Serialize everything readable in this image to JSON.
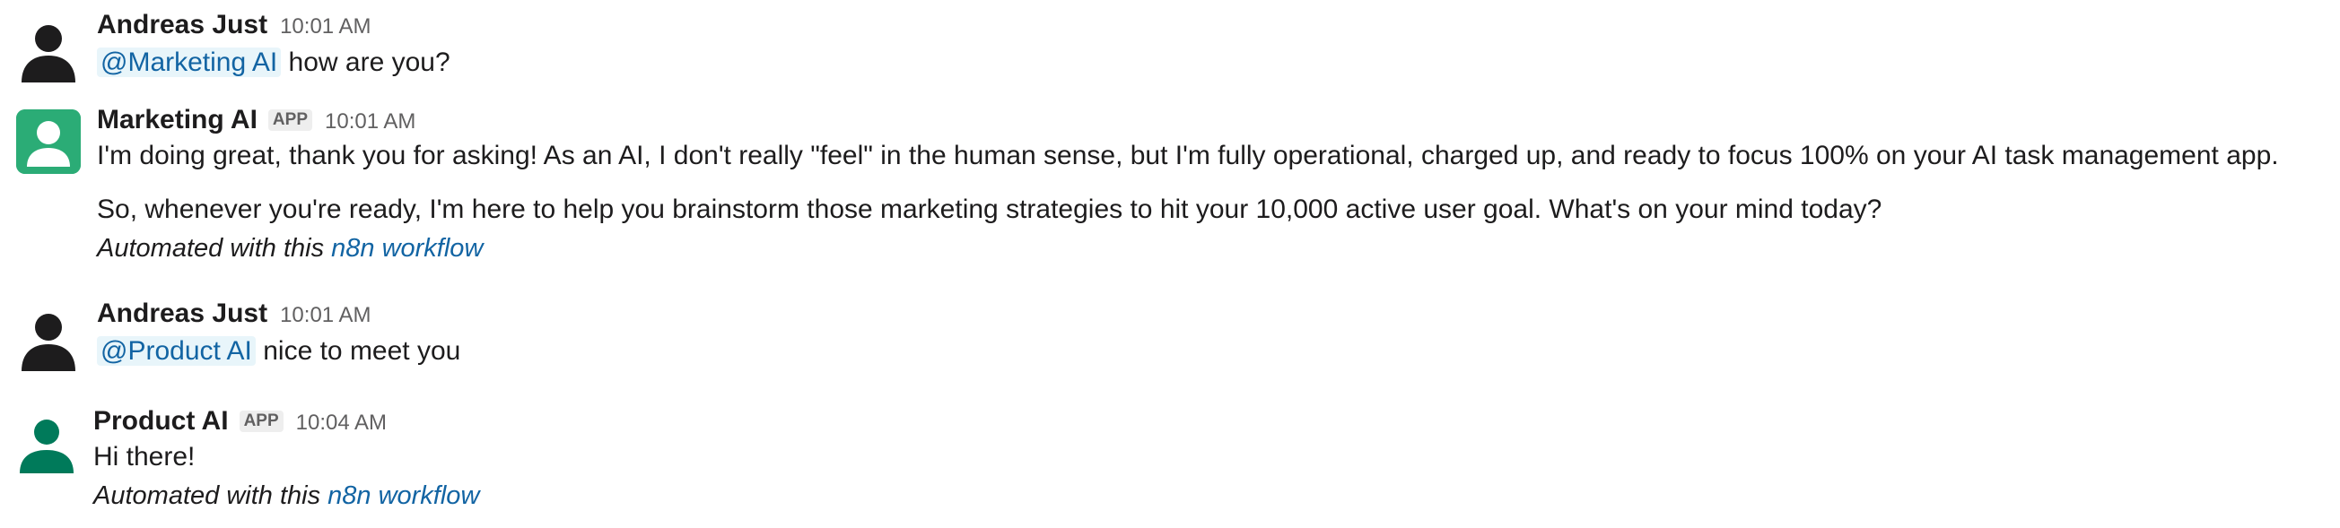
{
  "messages": [
    {
      "sender": "Andreas Just",
      "time": "10:01 AM",
      "mention": "@Marketing AI",
      "text": "how are you?"
    },
    {
      "sender": "Marketing AI",
      "badge": "APP",
      "time": "10:01 AM",
      "paragraphs": [
        "I'm doing great, thank you for asking! As an AI, I don't really \"feel\" in the human sense, but I'm fully operational, charged up, and ready to focus 100% on your AI task management app.",
        "So, whenever you're ready, I'm here to help you brainstorm those marketing strategies to hit your 10,000 active user goal. What's on your mind today?"
      ],
      "footer_prefix": "Automated with this",
      "footer_link": "n8n workflow"
    },
    {
      "sender": "Andreas Just",
      "time": "10:01 AM",
      "mention": "@Product AI",
      "text": "nice to meet you"
    },
    {
      "sender": "Product AI",
      "badge": "APP",
      "time": "10:04 AM",
      "paragraphs": [
        "Hi there!"
      ],
      "footer_prefix": "Automated with this",
      "footer_link": "n8n workflow"
    }
  ],
  "avatars": {
    "user_icon": "person-silhouette-icon",
    "user_color": "#1d1c1d",
    "marketing_bot_icon": "person-icon",
    "marketing_bot_color": "#2bac76",
    "product_bot_icon": "person-icon",
    "product_bot_color": "#007a5a"
  },
  "colors": {
    "link": "#1264a3",
    "mention_bg": "#e8f5fa",
    "text": "#1d1c1d",
    "muted": "#616061"
  }
}
